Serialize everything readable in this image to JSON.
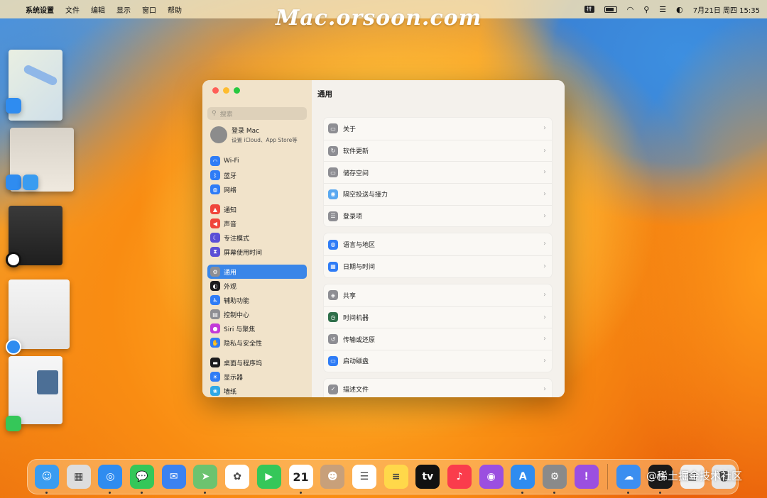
{
  "menubar": {
    "app_name": "系统设置",
    "menus": [
      "文件",
      "编辑",
      "显示",
      "窗口",
      "帮助"
    ],
    "input_method": "拼",
    "datetime": "7月21日 周四  15:35"
  },
  "watermark": "Mac.orsoon.com",
  "watermark2": "@稀土掘金技术社区",
  "window": {
    "title": "通用",
    "search_placeholder": "搜索",
    "account": {
      "title": "登录 Mac",
      "subtitle": "设置 iCloud、App Store等"
    },
    "sidebar_groups": [
      [
        {
          "label": "Wi‑Fi",
          "icon": "wifi-icon",
          "color": "#2f7cf6"
        },
        {
          "label": "蓝牙",
          "icon": "bluetooth-icon",
          "color": "#2f7cf6"
        },
        {
          "label": "网络",
          "icon": "globe-icon",
          "color": "#2f7cf6"
        }
      ],
      [
        {
          "label": "通知",
          "icon": "bell-icon",
          "color": "#f0453a"
        },
        {
          "label": "声音",
          "icon": "speaker-icon",
          "color": "#f0453a"
        },
        {
          "label": "专注模式",
          "icon": "moon-icon",
          "color": "#5b4fd6"
        },
        {
          "label": "屏幕使用时间",
          "icon": "hourglass-icon",
          "color": "#5b4fd6"
        }
      ],
      [
        {
          "label": "通用",
          "icon": "gear-icon",
          "color": "#8e8e93",
          "selected": true
        },
        {
          "label": "外观",
          "icon": "appearance-icon",
          "color": "#1c1c1e"
        },
        {
          "label": "辅助功能",
          "icon": "accessibility-icon",
          "color": "#2f7cf6"
        },
        {
          "label": "控制中心",
          "icon": "control-center-icon",
          "color": "#8e8e93"
        },
        {
          "label": "Siri 与聚焦",
          "icon": "siri-icon",
          "color": "#c33ad8"
        },
        {
          "label": "隐私与安全性",
          "icon": "hand-icon",
          "color": "#2f7cf6"
        }
      ],
      [
        {
          "label": "桌面与程序坞",
          "icon": "dock-icon",
          "color": "#1c1c1e"
        },
        {
          "label": "显示器",
          "icon": "display-icon",
          "color": "#2f7cf6"
        },
        {
          "label": "墙纸",
          "icon": "wallpaper-icon",
          "color": "#2fa8e6"
        }
      ]
    ],
    "settings_groups": [
      [
        {
          "label": "关于",
          "icon": "info-icon",
          "color": "#8e8e93"
        },
        {
          "label": "软件更新",
          "icon": "update-icon",
          "color": "#8e8e93"
        },
        {
          "label": "储存空间",
          "icon": "storage-icon",
          "color": "#8e8e93"
        },
        {
          "label": "隔空投送与接力",
          "icon": "airdrop-icon",
          "color": "#5aa8f0"
        },
        {
          "label": "登录项",
          "icon": "list-icon",
          "color": "#8e8e93"
        }
      ],
      [
        {
          "label": "语言与地区",
          "icon": "globe-icon",
          "color": "#2f7cf6"
        },
        {
          "label": "日期与时间",
          "icon": "calendar-icon",
          "color": "#2f7cf6"
        }
      ],
      [
        {
          "label": "共享",
          "icon": "sharing-icon",
          "color": "#8e8e93"
        },
        {
          "label": "时间机器",
          "icon": "time-machine-icon",
          "color": "#2f6f4a"
        },
        {
          "label": "传输或还原",
          "icon": "transfer-icon",
          "color": "#8e8e93"
        },
        {
          "label": "启动磁盘",
          "icon": "disk-icon",
          "color": "#2f7cf6"
        }
      ],
      [
        {
          "label": "描述文件",
          "icon": "profile-icon",
          "color": "#8e8e93"
        }
      ]
    ]
  },
  "dock": [
    {
      "name": "finder-icon",
      "color": "#3a9cf0",
      "glyph": "☺",
      "running": true
    },
    {
      "name": "launchpad-icon",
      "color": "#dddddd",
      "glyph": "▦",
      "running": false
    },
    {
      "name": "safari-icon",
      "color": "#2f8cf0",
      "glyph": "◎",
      "running": true
    },
    {
      "name": "messages-icon",
      "color": "#35c759",
      "glyph": "💬",
      "running": true
    },
    {
      "name": "mail-icon",
      "color": "#3b82f0",
      "glyph": "✉",
      "running": false
    },
    {
      "name": "maps-icon",
      "color": "#6cc36f",
      "glyph": "➤",
      "running": true
    },
    {
      "name": "photos-icon",
      "color": "#ffffff",
      "glyph": "✿",
      "running": false
    },
    {
      "name": "facetime-icon",
      "color": "#35c759",
      "glyph": "▶",
      "running": false
    },
    {
      "name": "calendar-icon",
      "color": "#ffffff",
      "glyph": "21",
      "running": true
    },
    {
      "name": "contacts-icon",
      "color": "#c8a07a",
      "glyph": "☻",
      "running": false
    },
    {
      "name": "reminders-icon",
      "color": "#ffffff",
      "glyph": "☰",
      "running": false
    },
    {
      "name": "notes-icon",
      "color": "#ffd84a",
      "glyph": "≡",
      "running": false
    },
    {
      "name": "tv-icon",
      "color": "#111111",
      "glyph": "tv",
      "running": false
    },
    {
      "name": "music-icon",
      "color": "#fa3c4c",
      "glyph": "♪",
      "running": false
    },
    {
      "name": "podcasts-icon",
      "color": "#9b4fe0",
      "glyph": "◉",
      "running": false
    },
    {
      "name": "app-store-icon",
      "color": "#2f8cf0",
      "glyph": "A",
      "running": true
    },
    {
      "name": "system-settings-icon",
      "color": "#8a8a8a",
      "glyph": "⚙",
      "running": true
    },
    {
      "name": "feedback-icon",
      "color": "#9b4fe0",
      "glyph": "!",
      "running": false
    },
    {
      "name": "weather-icon",
      "color": "#3b8ef0",
      "glyph": "☁",
      "running": true
    },
    {
      "name": "clock-icon",
      "color": "#1a1a1a",
      "glyph": "◷",
      "running": true
    },
    {
      "name": "document-icon",
      "color": "#f0f0f0",
      "glyph": "▤",
      "running": false
    },
    {
      "name": "trash-icon",
      "color": "#e6e6e6",
      "glyph": "🗑",
      "running": false
    }
  ]
}
